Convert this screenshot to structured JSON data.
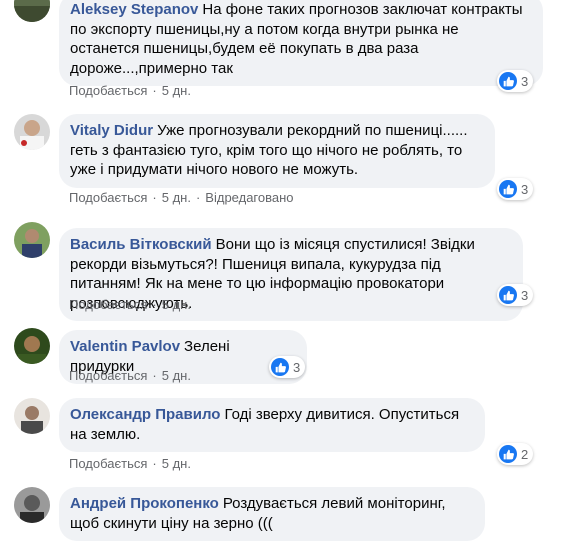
{
  "colors": {
    "author": "#385898",
    "bubble": "#f0f2f5",
    "meta": "#65676b",
    "like": "#1877f2"
  },
  "comments": [
    {
      "author": "Aleksey Stepanov",
      "text": "На фоне таких прогнозов заключат контракты по экспорту пшеницы,ну а потом когда внутри рынка не останется пшеницы,будем её покупать в два раза дороже...,примерно так",
      "like_label": "Подобається",
      "time": "5 дн.",
      "edited": "",
      "reactions": "3"
    },
    {
      "author": "Vitaly Didur",
      "text": "Уже прогнозували рекордний по пшениці...... геть з фантазією туго, крім того що нічого не роблять, то уже і придумати нічого нового не можуть.",
      "like_label": "Подобається",
      "time": "5 дн.",
      "edited": "Відредаговано",
      "reactions": "3"
    },
    {
      "author": "Василь Вітковский",
      "text": "Вони що із місяця спустилися! Звідки рекорди візьмуться?! Пшениця випала, кукурудза під питанням! Як на мене то цю інформацію провокатори розповсюджують.",
      "like_label": "Подобається",
      "time": "5 дн.",
      "edited": "",
      "reactions": "3"
    },
    {
      "author": "Valentin Pavlov",
      "text": "Зелені придурки",
      "like_label": "Подобається",
      "time": "5 дн.",
      "edited": "",
      "reactions": "3"
    },
    {
      "author": "Олександр Правило",
      "text": "Годі зверху дивитися. Опуститься на землю.",
      "like_label": "Подобається",
      "time": "5 дн.",
      "edited": "",
      "reactions": "2"
    },
    {
      "author": "Андрей Прокопенко",
      "text": "Роздувається левий моніторинг, щоб скинути ціну на зерно (((",
      "like_label": "",
      "time": "",
      "edited": "",
      "reactions": ""
    }
  ]
}
